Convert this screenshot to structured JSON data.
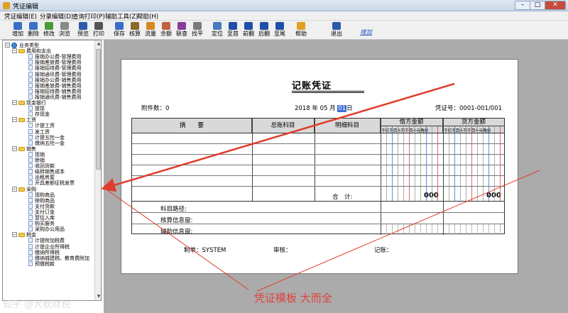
{
  "window": {
    "title": "凭证编辑",
    "min": "–",
    "max": "□",
    "close": "✕"
  },
  "menu": [
    "凭证编辑(E)",
    "分录编辑(D)",
    "查询打印(P)",
    "辅助工具(Z)",
    "帮助(H)"
  ],
  "toolbar": {
    "buttons": [
      {
        "label": "增加",
        "icon": "add-icon",
        "color": "#3a6fc8"
      },
      {
        "label": "删除",
        "icon": "delete-icon",
        "color": "#3a6fc8"
      },
      {
        "label": "修改",
        "icon": "edit-icon",
        "color": "#4a9a3a"
      },
      {
        "label": "浏览",
        "icon": "browse-icon",
        "color": "#8a8a8a"
      },
      {
        "label": "预览",
        "icon": "preview-icon",
        "color": "#2c5aa8"
      },
      {
        "label": "打印",
        "icon": "print-icon",
        "color": "#555555"
      },
      {
        "label": "保存",
        "icon": "save-icon",
        "color": "#3a6fc8"
      },
      {
        "label": "核算",
        "icon": "calculate-icon",
        "color": "#8a6a2a"
      },
      {
        "label": "流量",
        "icon": "flow-icon",
        "color": "#d48a20"
      },
      {
        "label": "余额",
        "icon": "balance-icon",
        "color": "#c06040"
      },
      {
        "label": "联查",
        "icon": "query-icon",
        "color": "#8a3a9a"
      },
      {
        "label": "找平",
        "icon": "level-icon",
        "color": "#7a7a7a"
      },
      {
        "label": "定位",
        "icon": "locate-icon",
        "color": "#4a7aba"
      },
      {
        "label": "至首",
        "icon": "first-icon",
        "color": "#1f4fa8"
      },
      {
        "label": "前翻",
        "icon": "prev-icon",
        "color": "#1f4fa8"
      },
      {
        "label": "后翻",
        "icon": "next-icon",
        "color": "#1f4fa8"
      },
      {
        "label": "至尾",
        "icon": "last-icon",
        "color": "#1f4fa8"
      },
      {
        "label": "帮助",
        "icon": "help-icon",
        "color": "#e0a020"
      },
      {
        "label": "退出",
        "icon": "exit-icon",
        "color": "#2c5aa8"
      }
    ],
    "link": "增加"
  },
  "tree": [
    {
      "label": "业务类型",
      "kind": "root",
      "level": 0
    },
    {
      "label": "费用和支出",
      "kind": "folder",
      "level": 1
    },
    {
      "label": "报销办公费-管理费用",
      "kind": "leaf",
      "level": 2
    },
    {
      "label": "报销差旅费-管理费用",
      "kind": "leaf",
      "level": 2
    },
    {
      "label": "报销招待费-管理费用",
      "kind": "leaf",
      "level": 2
    },
    {
      "label": "报销通讯费-管理费用",
      "kind": "leaf",
      "level": 2
    },
    {
      "label": "报销办公费-销售费用",
      "kind": "leaf",
      "level": 2
    },
    {
      "label": "报销差旅费-销售费用",
      "kind": "leaf",
      "level": 2
    },
    {
      "label": "报销招待费-销售费用",
      "kind": "leaf",
      "level": 2
    },
    {
      "label": "报销通讯费-销售费用",
      "kind": "leaf",
      "level": 2
    },
    {
      "label": "现金银行",
      "kind": "folder",
      "level": 1
    },
    {
      "label": "提现",
      "kind": "leaf",
      "level": 2
    },
    {
      "label": "存现金",
      "kind": "leaf",
      "level": 2
    },
    {
      "label": "工资",
      "kind": "folder",
      "level": 1
    },
    {
      "label": "计提工资",
      "kind": "leaf",
      "level": 2
    },
    {
      "label": "发工资",
      "kind": "leaf",
      "level": 2
    },
    {
      "label": "计提五险一金",
      "kind": "leaf",
      "level": 2
    },
    {
      "label": "缴纳五险一金",
      "kind": "leaf",
      "level": 2
    },
    {
      "label": "销售",
      "kind": "folder",
      "level": 1
    },
    {
      "label": "现销",
      "kind": "leaf",
      "level": 2
    },
    {
      "label": "赊销",
      "kind": "leaf",
      "level": 2
    },
    {
      "label": "收回货款",
      "kind": "leaf",
      "level": 2
    },
    {
      "label": "结转销售成本",
      "kind": "leaf",
      "level": 2
    },
    {
      "label": "出租房屋",
      "kind": "leaf",
      "level": 2
    },
    {
      "label": "开具差额征税发票",
      "kind": "leaf",
      "level": 2
    },
    {
      "label": "采购",
      "kind": "folder",
      "level": 1
    },
    {
      "label": "现购商品",
      "kind": "leaf",
      "level": 2
    },
    {
      "label": "赊购商品",
      "kind": "leaf",
      "level": 2
    },
    {
      "label": "支付货款",
      "kind": "leaf",
      "level": 2
    },
    {
      "label": "支付订金",
      "kind": "leaf",
      "level": 2
    },
    {
      "label": "暂估入库",
      "kind": "leaf",
      "level": 2
    },
    {
      "label": "购买服务",
      "kind": "leaf",
      "level": 2
    },
    {
      "label": "采购办公用品",
      "kind": "leaf",
      "level": 2
    },
    {
      "label": "税金",
      "kind": "folder",
      "level": 1
    },
    {
      "label": "计提附加税费",
      "kind": "leaf",
      "level": 2
    },
    {
      "label": "计提企业所得税",
      "kind": "leaf",
      "level": 2
    },
    {
      "label": "缴纳所得税",
      "kind": "leaf",
      "level": 2
    },
    {
      "label": "缴纳城建税、教育费附加",
      "kind": "leaf",
      "level": 2
    },
    {
      "label": "预缴税款",
      "kind": "leaf",
      "level": 2
    }
  ],
  "voucher": {
    "title": "记账凭证",
    "attachments_label": "附件数：",
    "attachments": "0",
    "year": "2018",
    "year_unit": "年",
    "month": "05",
    "month_unit": "月",
    "day": "01",
    "day_unit": "日",
    "number_label": "凭证号：",
    "number": "0001-001/001",
    "col_summary": "摘　　要",
    "col_account": "总账科目",
    "col_detail": "明细科目",
    "col_debit": "借方金额",
    "col_credit": "贷方金额",
    "digit_units": "千亿千百十万千百十元角分",
    "total_label": "合　计:",
    "debit_total": "000",
    "credit_total": "000",
    "path_label": "科目路径:",
    "check_label": "核算信息窗:",
    "aux_label": "辅助信息窗:",
    "maker_label": "制单：",
    "maker": "SYSTEM",
    "auditor_label": "审核：",
    "bookkeeper_label": "记账："
  },
  "annotation": "凭证模板 大而全",
  "watermark": "知乎 @大秋财税"
}
